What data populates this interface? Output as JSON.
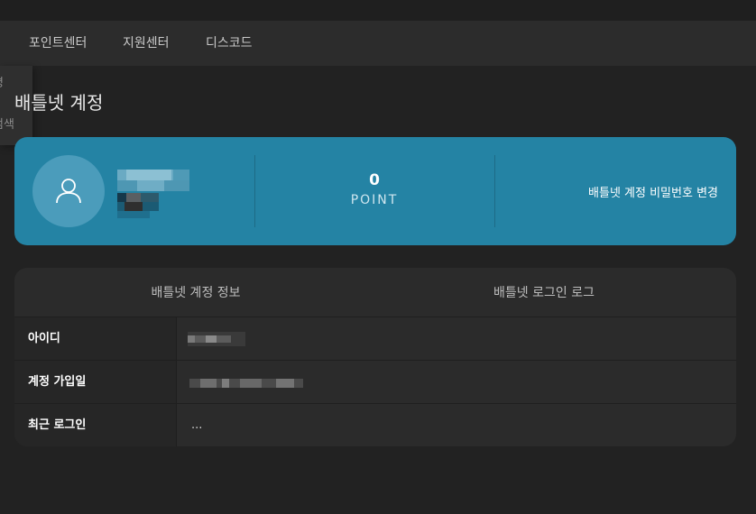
{
  "nav": {
    "items": [
      {
        "label": "포인트센터"
      },
      {
        "label": "지원센터"
      },
      {
        "label": "디스코드"
      }
    ]
  },
  "side_menu": {
    "line1": "명",
    "line2": "검색"
  },
  "page": {
    "title": "배틀넷 계정"
  },
  "profile": {
    "point_value": "0",
    "point_label": "POINT",
    "change_password_label": "배틀넷 계정 비밀번호 변경"
  },
  "info": {
    "tabs": [
      {
        "label": "배틀넷 계정 정보"
      },
      {
        "label": "배틀넷 로그인 로그"
      }
    ],
    "rows": [
      {
        "label": "아이디",
        "value": ""
      },
      {
        "label": "계정 가입일",
        "value": ""
      },
      {
        "label": "최근 로그인",
        "value": "..."
      }
    ]
  },
  "colors": {
    "accent": "#2483a4",
    "background": "#222222",
    "card": "#2b2b2b"
  },
  "icons": {
    "avatar": "user-icon"
  }
}
